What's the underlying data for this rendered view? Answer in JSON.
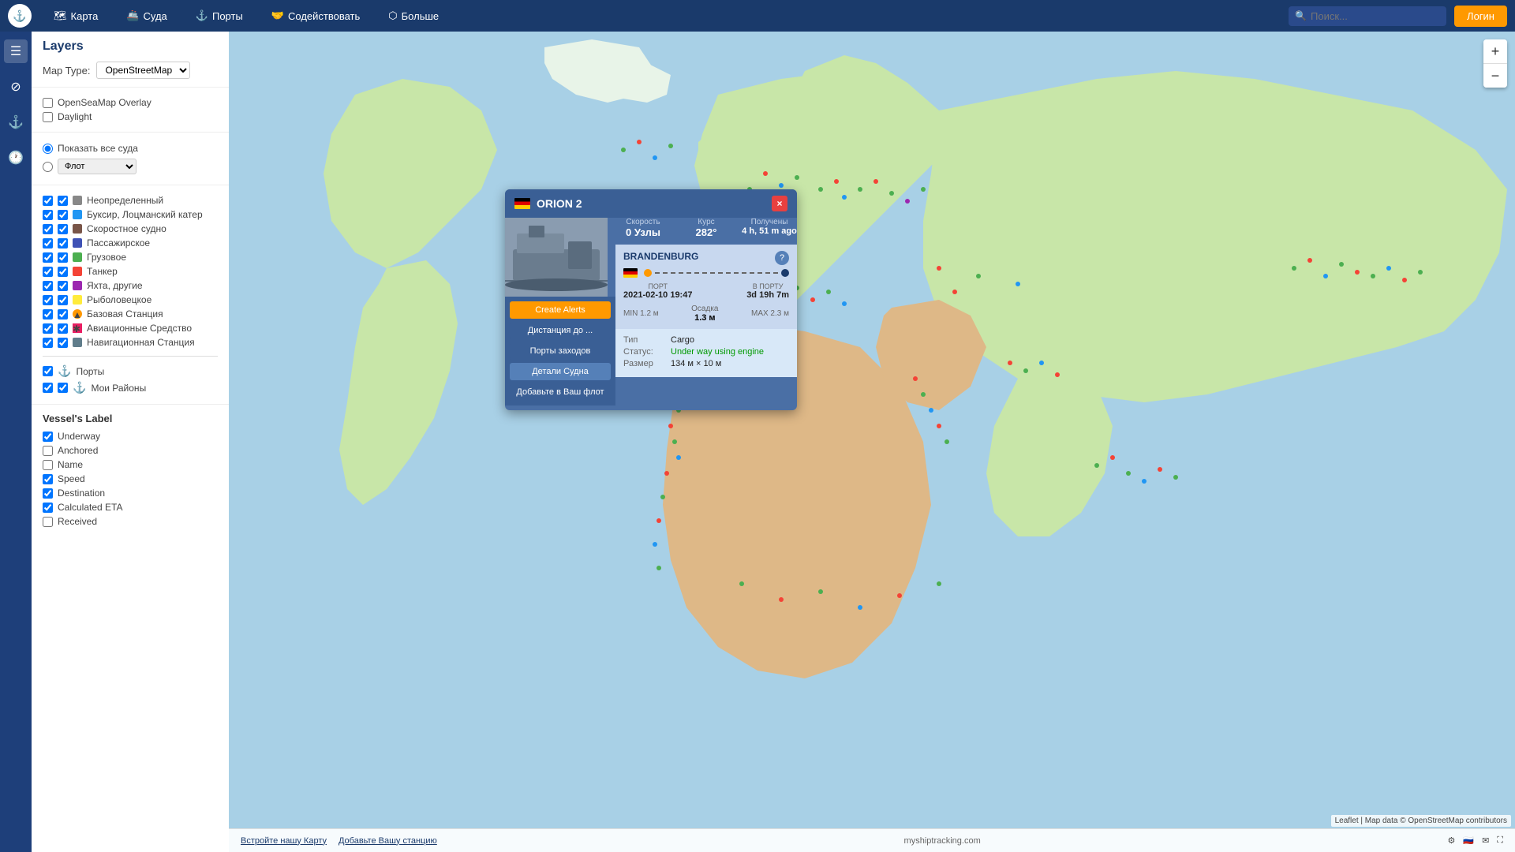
{
  "nav": {
    "logo": "⚓",
    "items": [
      {
        "label": "Карта",
        "icon": "🗺"
      },
      {
        "label": "Суда",
        "icon": "🚢"
      },
      {
        "label": "Порты",
        "icon": "⚓"
      },
      {
        "label": "Содействовать",
        "icon": "🤝"
      },
      {
        "label": "Больше",
        "icon": "⬡"
      }
    ],
    "search_placeholder": "Поиск...",
    "login_label": "Логин"
  },
  "sidebar_icons": [
    "≡",
    "🔍",
    "⚓",
    "🕐"
  ],
  "layers_panel": {
    "title": "Layers",
    "map_type_label": "Map Type:",
    "map_type_value": "OpenStreetMap",
    "overlays": [
      {
        "label": "OpenSeaMap Overlay",
        "checked": false
      },
      {
        "label": "Daylight",
        "checked": false
      }
    ],
    "show_all_vessels": "Показать все суда",
    "fleet_placeholder": "Флот",
    "vessel_types": [
      {
        "label": "Неопределенный",
        "color": "#888",
        "checked": true
      },
      {
        "label": "Буксир, Лоцманский катер",
        "color": "#2196F3",
        "checked": true
      },
      {
        "label": "Скоростное судно",
        "color": "#795548",
        "checked": true
      },
      {
        "label": "Пассажирское",
        "color": "#3F51B5",
        "checked": true
      },
      {
        "label": "Грузовое",
        "color": "#4CAF50",
        "checked": true
      },
      {
        "label": "Танкер",
        "color": "#F44336",
        "checked": true
      },
      {
        "label": "Яхта, другие",
        "color": "#9C27B0",
        "checked": true
      },
      {
        "label": "Рыболовецкое",
        "color": "#FFEB3B",
        "checked": true
      },
      {
        "label": "Базовая Станция",
        "color": "#FF9800",
        "checked": true
      },
      {
        "label": "Авиационные Средство",
        "color": "#E91E63",
        "checked": true
      },
      {
        "label": "Навигационная Станция",
        "color": "#607D8B",
        "checked": true
      }
    ],
    "ports": {
      "label": "Порты",
      "checked": true
    },
    "my_areas": {
      "label": "Мои Районы",
      "checked": true
    }
  },
  "vessel_labels": {
    "title": "Vessel's Label",
    "items": [
      {
        "label": "Underway",
        "checked": true
      },
      {
        "label": "Anchored",
        "checked": false
      },
      {
        "label": "Name",
        "checked": false
      },
      {
        "label": "Speed",
        "checked": true
      },
      {
        "label": "Destination",
        "checked": true
      },
      {
        "label": "Calculated ETA",
        "checked": true
      },
      {
        "label": "Received",
        "checked": false
      }
    ]
  },
  "ship_popup": {
    "name": "ORION 2",
    "speed_label": "Скорость",
    "speed_value": "0 Узлы",
    "course_label": "Курс",
    "course_value": "282°",
    "received_label": "Получены",
    "received_value": "4 h, 51 m ago",
    "route_title": "BRANDENBURG",
    "port_label": "ПОРТ",
    "port_value": "2021-02-10 19:47",
    "in_port_label": "В ПОРТУ",
    "in_port_value": "3d 19h 7m",
    "draft_min": "MIN 1.2 м",
    "draft_label": "Осадка",
    "draft_value": "1.3 м",
    "draft_max": "MAX 2.3 м",
    "type_label": "Тип",
    "type_value": "Cargo",
    "status_label": "Статус:",
    "status_value": "Under way using engine",
    "size_label": "Размер",
    "size_value": "134 м × 10 м",
    "btn_alerts": "Create Alerts",
    "btn_distance": "Дистанция до ...",
    "btn_ports": "Порты заходов",
    "btn_details": "Детали Судна",
    "btn_fleet": "Добавьте в Ваш флот",
    "close": "×"
  },
  "footer": {
    "left_links": [
      "Встройте нашу Карту",
      "Добавьте Вашу станцию"
    ],
    "center": "myshiptracking.com",
    "attribution": "Leaflet | Map data © OpenStreetMap contributors"
  },
  "zoom": {
    "plus": "+",
    "minus": "−"
  }
}
